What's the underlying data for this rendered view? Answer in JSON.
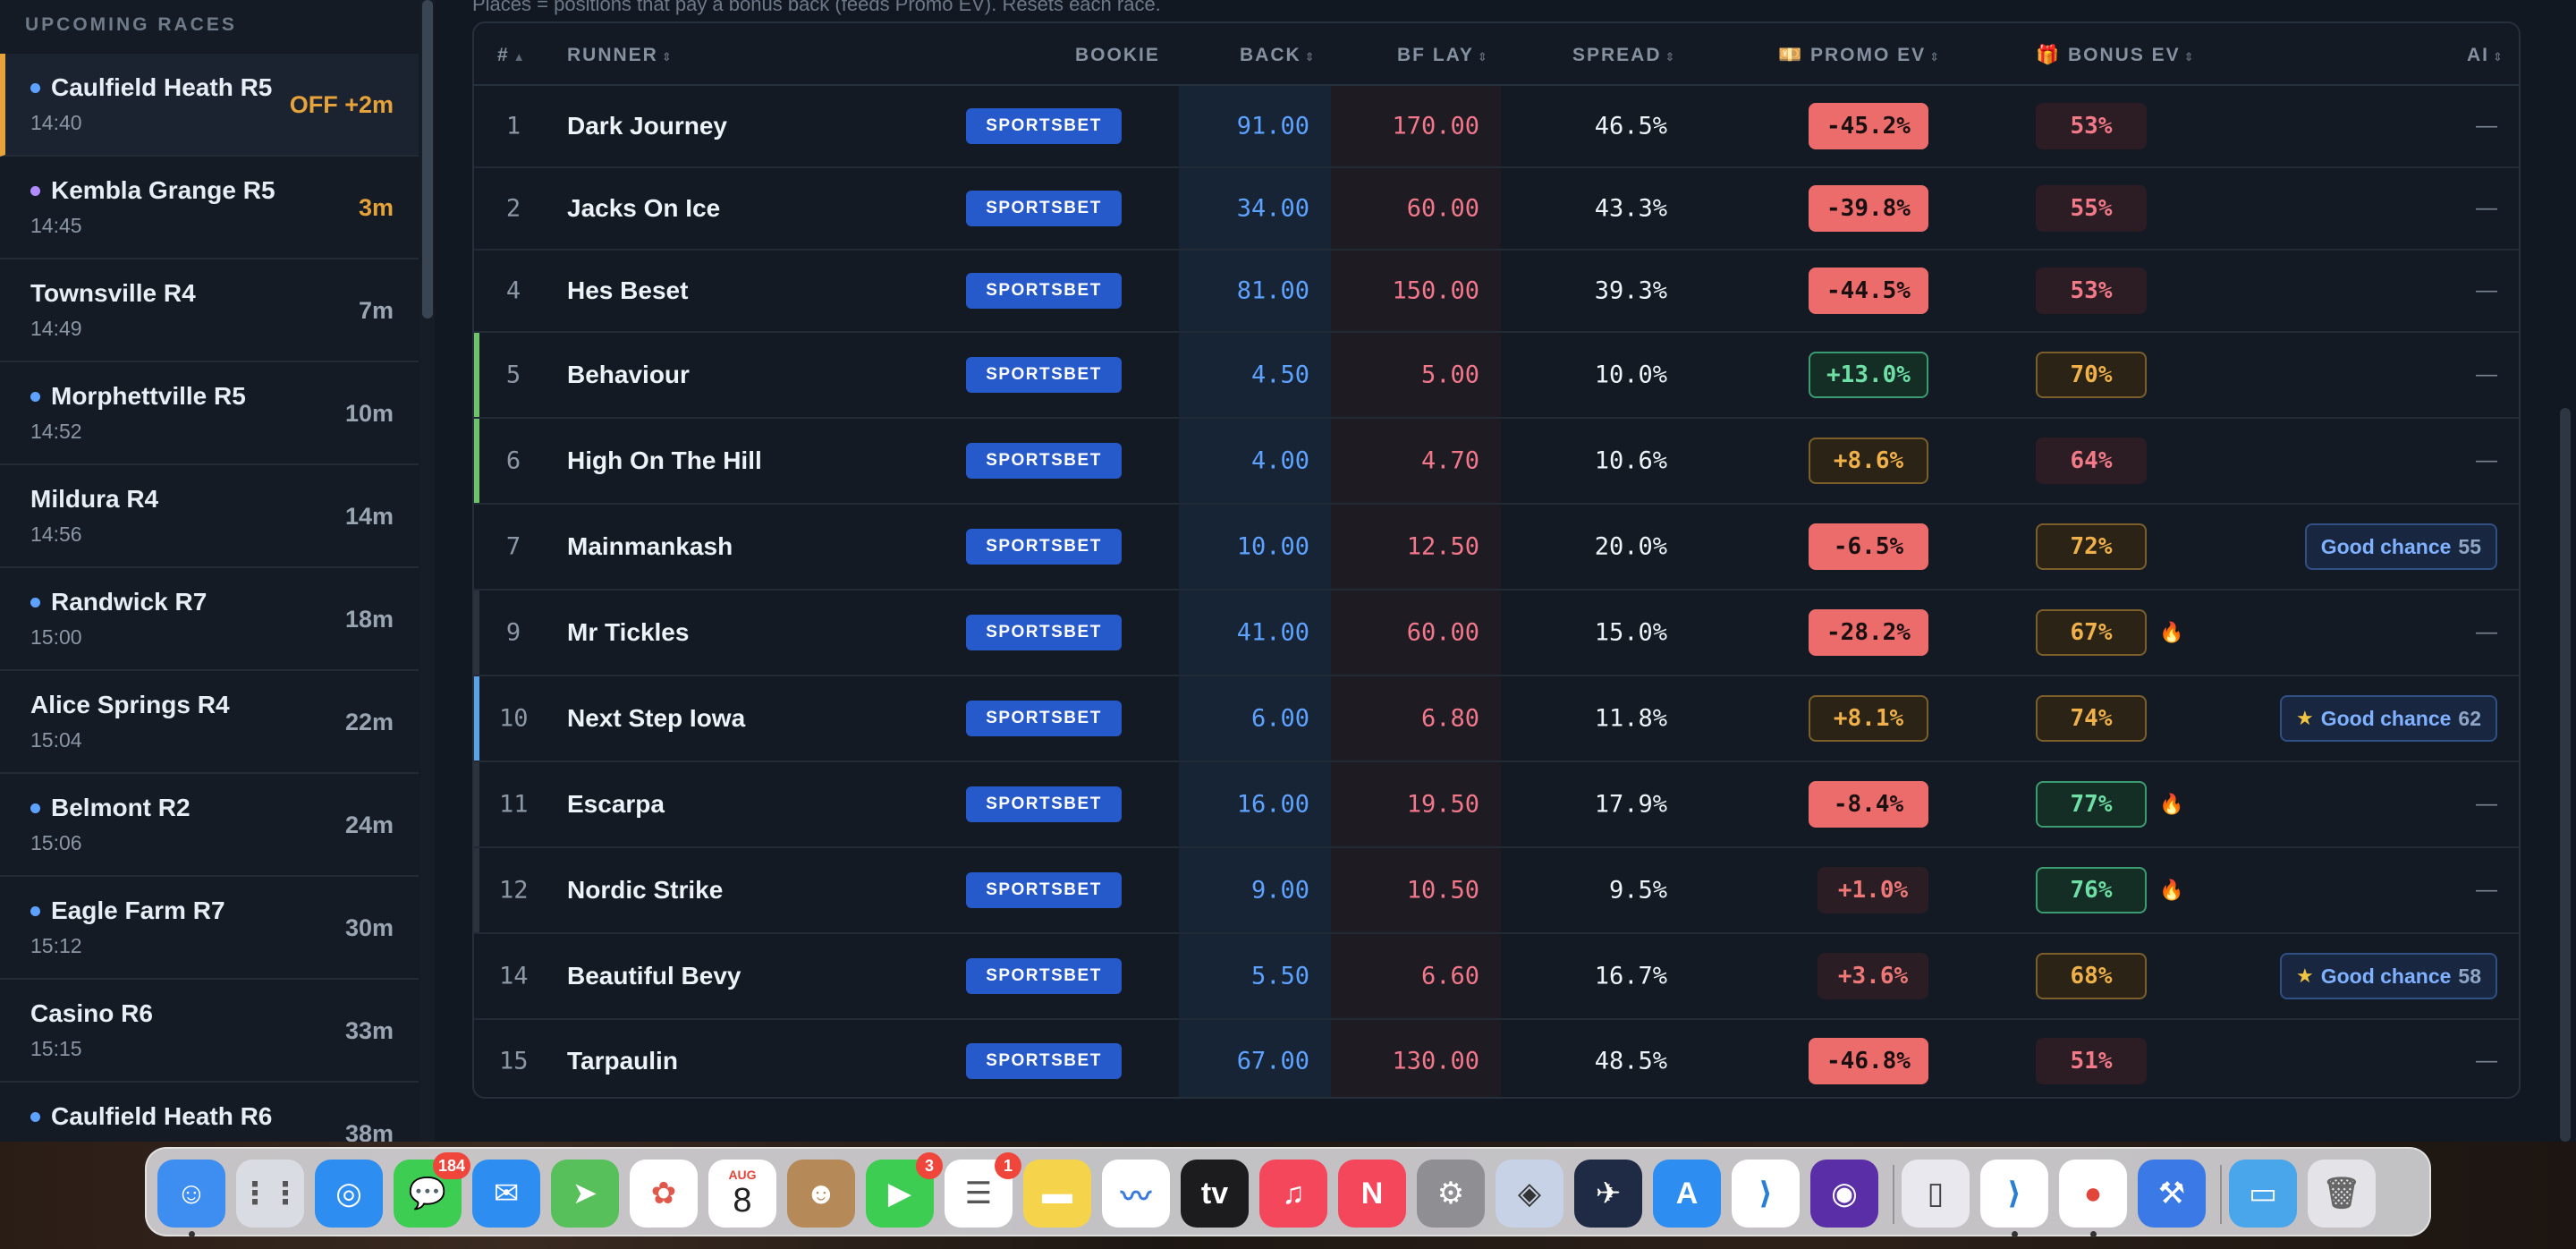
{
  "sidebar": {
    "header": "UPCOMING RACES",
    "races": [
      {
        "name": "Caulfield Heath R5",
        "time": "14:40",
        "eta": "OFF +2m",
        "dot": "#5ea2ff",
        "active": true
      },
      {
        "name": "Kembla Grange R5",
        "time": "14:45",
        "eta": "3m",
        "dot": "#b28cff",
        "warn": true
      },
      {
        "name": "Townsville R4",
        "time": "14:49",
        "eta": "7m"
      },
      {
        "name": "Morphettville R5",
        "time": "14:52",
        "eta": "10m",
        "dot": "#5ea2ff"
      },
      {
        "name": "Mildura R4",
        "time": "14:56",
        "eta": "14m"
      },
      {
        "name": "Randwick R7",
        "time": "15:00",
        "eta": "18m",
        "dot": "#5ea2ff"
      },
      {
        "name": "Alice Springs R4",
        "time": "15:04",
        "eta": "22m"
      },
      {
        "name": "Belmont R2",
        "time": "15:06",
        "eta": "24m",
        "dot": "#5ea2ff"
      },
      {
        "name": "Eagle Farm R7",
        "time": "15:12",
        "eta": "30m",
        "dot": "#5ea2ff"
      },
      {
        "name": "Casino R6",
        "time": "15:15",
        "eta": "33m"
      },
      {
        "name": "Caulfield Heath R6",
        "time": "",
        "eta": "38m",
        "dot": "#5ea2ff"
      }
    ]
  },
  "caption": "Places = positions that pay a bonus back (feeds Promo EV). Resets each race.",
  "table": {
    "headers": {
      "num": "#",
      "runner": "RUNNER",
      "bookie": "BOOKIE",
      "back": "BACK",
      "lay": "BF LAY",
      "spread": "SPREAD",
      "promo": "💴 PROMO EV",
      "bonus": "🎁 BONUS EV",
      "ai": "AI"
    },
    "rows": [
      {
        "num": "1",
        "runner": "Dark Journey",
        "bookie": "SPORTSBET",
        "back": "91.00",
        "lay": "170.00",
        "spread": "46.5%",
        "promo": "-45.2%",
        "promo_style": "red",
        "bonus": "53%",
        "bonus_style": "pink",
        "fire": "",
        "ai": "—",
        "bar": ""
      },
      {
        "num": "2",
        "runner": "Jacks On Ice",
        "bookie": "SPORTSBET",
        "back": "34.00",
        "lay": "60.00",
        "spread": "43.3%",
        "promo": "-39.8%",
        "promo_style": "red",
        "bonus": "55%",
        "bonus_style": "pink",
        "fire": "",
        "ai": "—",
        "bar": ""
      },
      {
        "num": "4",
        "runner": "Hes Beset",
        "bookie": "SPORTSBET",
        "back": "81.00",
        "lay": "150.00",
        "spread": "39.3%",
        "promo": "-44.5%",
        "promo_style": "red",
        "bonus": "53%",
        "bonus_style": "pink",
        "fire": "",
        "ai": "—",
        "bar": ""
      },
      {
        "num": "5",
        "runner": "Behaviour",
        "bookie": "SPORTSBET",
        "back": "4.50",
        "lay": "5.00",
        "spread": "10.0%",
        "promo": "+13.0%",
        "promo_style": "green",
        "bonus": "70%",
        "bonus_style": "amber",
        "fire": "",
        "ai": "—",
        "bar": "#6cc36a"
      },
      {
        "num": "6",
        "runner": "High On The Hill",
        "bookie": "SPORTSBET",
        "back": "4.00",
        "lay": "4.70",
        "spread": "10.6%",
        "promo": "+8.6%",
        "promo_style": "amber",
        "bonus": "64%",
        "bonus_style": "pink",
        "fire": "",
        "ai": "—",
        "bar": "#6cc36a"
      },
      {
        "num": "7",
        "runner": "Mainmankash",
        "bookie": "SPORTSBET",
        "back": "10.00",
        "lay": "12.50",
        "spread": "20.0%",
        "promo": "-6.5%",
        "promo_style": "red",
        "bonus": "72%",
        "bonus_style": "amber",
        "fire": "",
        "ai": "Good chance",
        "ai_score": "55",
        "ai_star": false,
        "bar": ""
      },
      {
        "num": "9",
        "runner": "Mr Tickles",
        "bookie": "SPORTSBET",
        "back": "41.00",
        "lay": "60.00",
        "spread": "15.0%",
        "promo": "-28.2%",
        "promo_style": "red",
        "bonus": "67%",
        "bonus_style": "amber",
        "fire": "🔥",
        "ai": "—",
        "bar": "#2c333d"
      },
      {
        "num": "10",
        "runner": "Next Step Iowa",
        "bookie": "SPORTSBET",
        "back": "6.00",
        "lay": "6.80",
        "spread": "11.8%",
        "promo": "+8.1%",
        "promo_style": "amber",
        "bonus": "74%",
        "bonus_style": "amber",
        "fire": "",
        "ai": "Good chance",
        "ai_score": "62",
        "ai_star": true,
        "bar": "#5aa2e6"
      },
      {
        "num": "11",
        "runner": "Escarpa",
        "bookie": "SPORTSBET",
        "back": "16.00",
        "lay": "19.50",
        "spread": "17.9%",
        "promo": "-8.4%",
        "promo_style": "red",
        "bonus": "77%",
        "bonus_style": "green",
        "fire": "🔥",
        "ai": "—",
        "bar": "#2c333d"
      },
      {
        "num": "12",
        "runner": "Nordic Strike",
        "bookie": "SPORTSBET",
        "back": "9.00",
        "lay": "10.50",
        "spread": "9.5%",
        "promo": "+1.0%",
        "promo_style": "reddim",
        "bonus": "76%",
        "bonus_style": "green",
        "fire": "🔥",
        "ai": "—",
        "bar": "#2c333d"
      },
      {
        "num": "14",
        "runner": "Beautiful Bevy",
        "bookie": "SPORTSBET",
        "back": "5.50",
        "lay": "6.60",
        "spread": "16.7%",
        "promo": "+3.6%",
        "promo_style": "reddim",
        "bonus": "68%",
        "bonus_style": "amber",
        "fire": "",
        "ai": "Good chance",
        "ai_score": "58",
        "ai_star": true,
        "bar": ""
      },
      {
        "num": "15",
        "runner": "Tarpaulin",
        "bookie": "SPORTSBET",
        "back": "67.00",
        "lay": "130.00",
        "spread": "48.5%",
        "promo": "-46.8%",
        "promo_style": "red",
        "bonus": "51%",
        "bonus_style": "pink",
        "fire": "",
        "ai": "—",
        "bar": ""
      }
    ]
  },
  "dock": {
    "apps": [
      {
        "name": "finder-icon",
        "glyph": "☺",
        "bg": "#3d8ef0",
        "dot": true
      },
      {
        "name": "launchpad-icon",
        "glyph": "⋮⋮",
        "bg": "#d9dce3",
        "fg": "#555"
      },
      {
        "name": "safari-icon",
        "glyph": "◎",
        "bg": "#2d8df0"
      },
      {
        "name": "messages-icon",
        "glyph": "💬",
        "bg": "#3ccd52",
        "badge": "184"
      },
      {
        "name": "mail-icon",
        "glyph": "✉",
        "bg": "#2d8df0"
      },
      {
        "name": "maps-icon",
        "glyph": "➤",
        "bg": "#58c05a"
      },
      {
        "name": "photos-icon",
        "glyph": "✿",
        "bg": "#ffffff",
        "fg": "#e0584a"
      },
      {
        "name": "calendar-icon",
        "glyph": "8",
        "bg": "#ffffff",
        "fg": "#222",
        "month": "AUG"
      },
      {
        "name": "contacts-icon",
        "glyph": "☻",
        "bg": "#b58a58"
      },
      {
        "name": "facetime-icon",
        "glyph": "▶",
        "bg": "#3ccd52",
        "badge": "3"
      },
      {
        "name": "reminders-icon",
        "glyph": "☰",
        "bg": "#ffffff",
        "fg": "#555",
        "badge": "1"
      },
      {
        "name": "notes-icon",
        "glyph": "▬",
        "bg": "#f5d34a",
        "fg": "#fff"
      },
      {
        "name": "freeform-icon",
        "glyph": "〰",
        "bg": "#ffffff",
        "fg": "#3a7ae0"
      },
      {
        "name": "apple-tv-icon",
        "glyph": "tv",
        "bg": "#1c1c1e"
      },
      {
        "name": "music-icon",
        "glyph": "♫",
        "bg": "#f4475c"
      },
      {
        "name": "news-icon",
        "glyph": "N",
        "bg": "#f4475c"
      },
      {
        "name": "system-settings-icon",
        "glyph": "⚙",
        "bg": "#8e8e93"
      },
      {
        "name": "unity-icon",
        "glyph": "◈",
        "bg": "#c7d2e6",
        "fg": "#333"
      },
      {
        "name": "telegram-icon",
        "glyph": "✈",
        "bg": "#1f2a44"
      },
      {
        "name": "app-store-icon",
        "glyph": "A",
        "bg": "#2d8df0"
      },
      {
        "name": "vscode-icon",
        "glyph": "⟩",
        "bg": "#ffffff",
        "fg": "#2a7fd4"
      },
      {
        "name": "firefox-icon",
        "glyph": "◉",
        "bg": "#5a2ea6"
      },
      {
        "name": "iphone-mirroring-icon",
        "glyph": "▯",
        "bg": "#e8e8ee",
        "fg": "#444"
      },
      {
        "name": "vscode-alt-icon",
        "glyph": "⟩",
        "bg": "#ffffff",
        "fg": "#2a7fd4",
        "dot": true
      },
      {
        "name": "chrome-icon",
        "glyph": "●",
        "bg": "#ffffff",
        "fg": "#e3453a",
        "dot": true
      },
      {
        "name": "xcode-icon",
        "glyph": "⚒",
        "bg": "#3b7ae6"
      },
      {
        "name": "downloads-folder-icon",
        "glyph": "▭",
        "bg": "#4aa6ea"
      },
      {
        "name": "trash-icon",
        "glyph": "🗑",
        "bg": "#e3e3e8",
        "fg": "#666"
      }
    ]
  }
}
